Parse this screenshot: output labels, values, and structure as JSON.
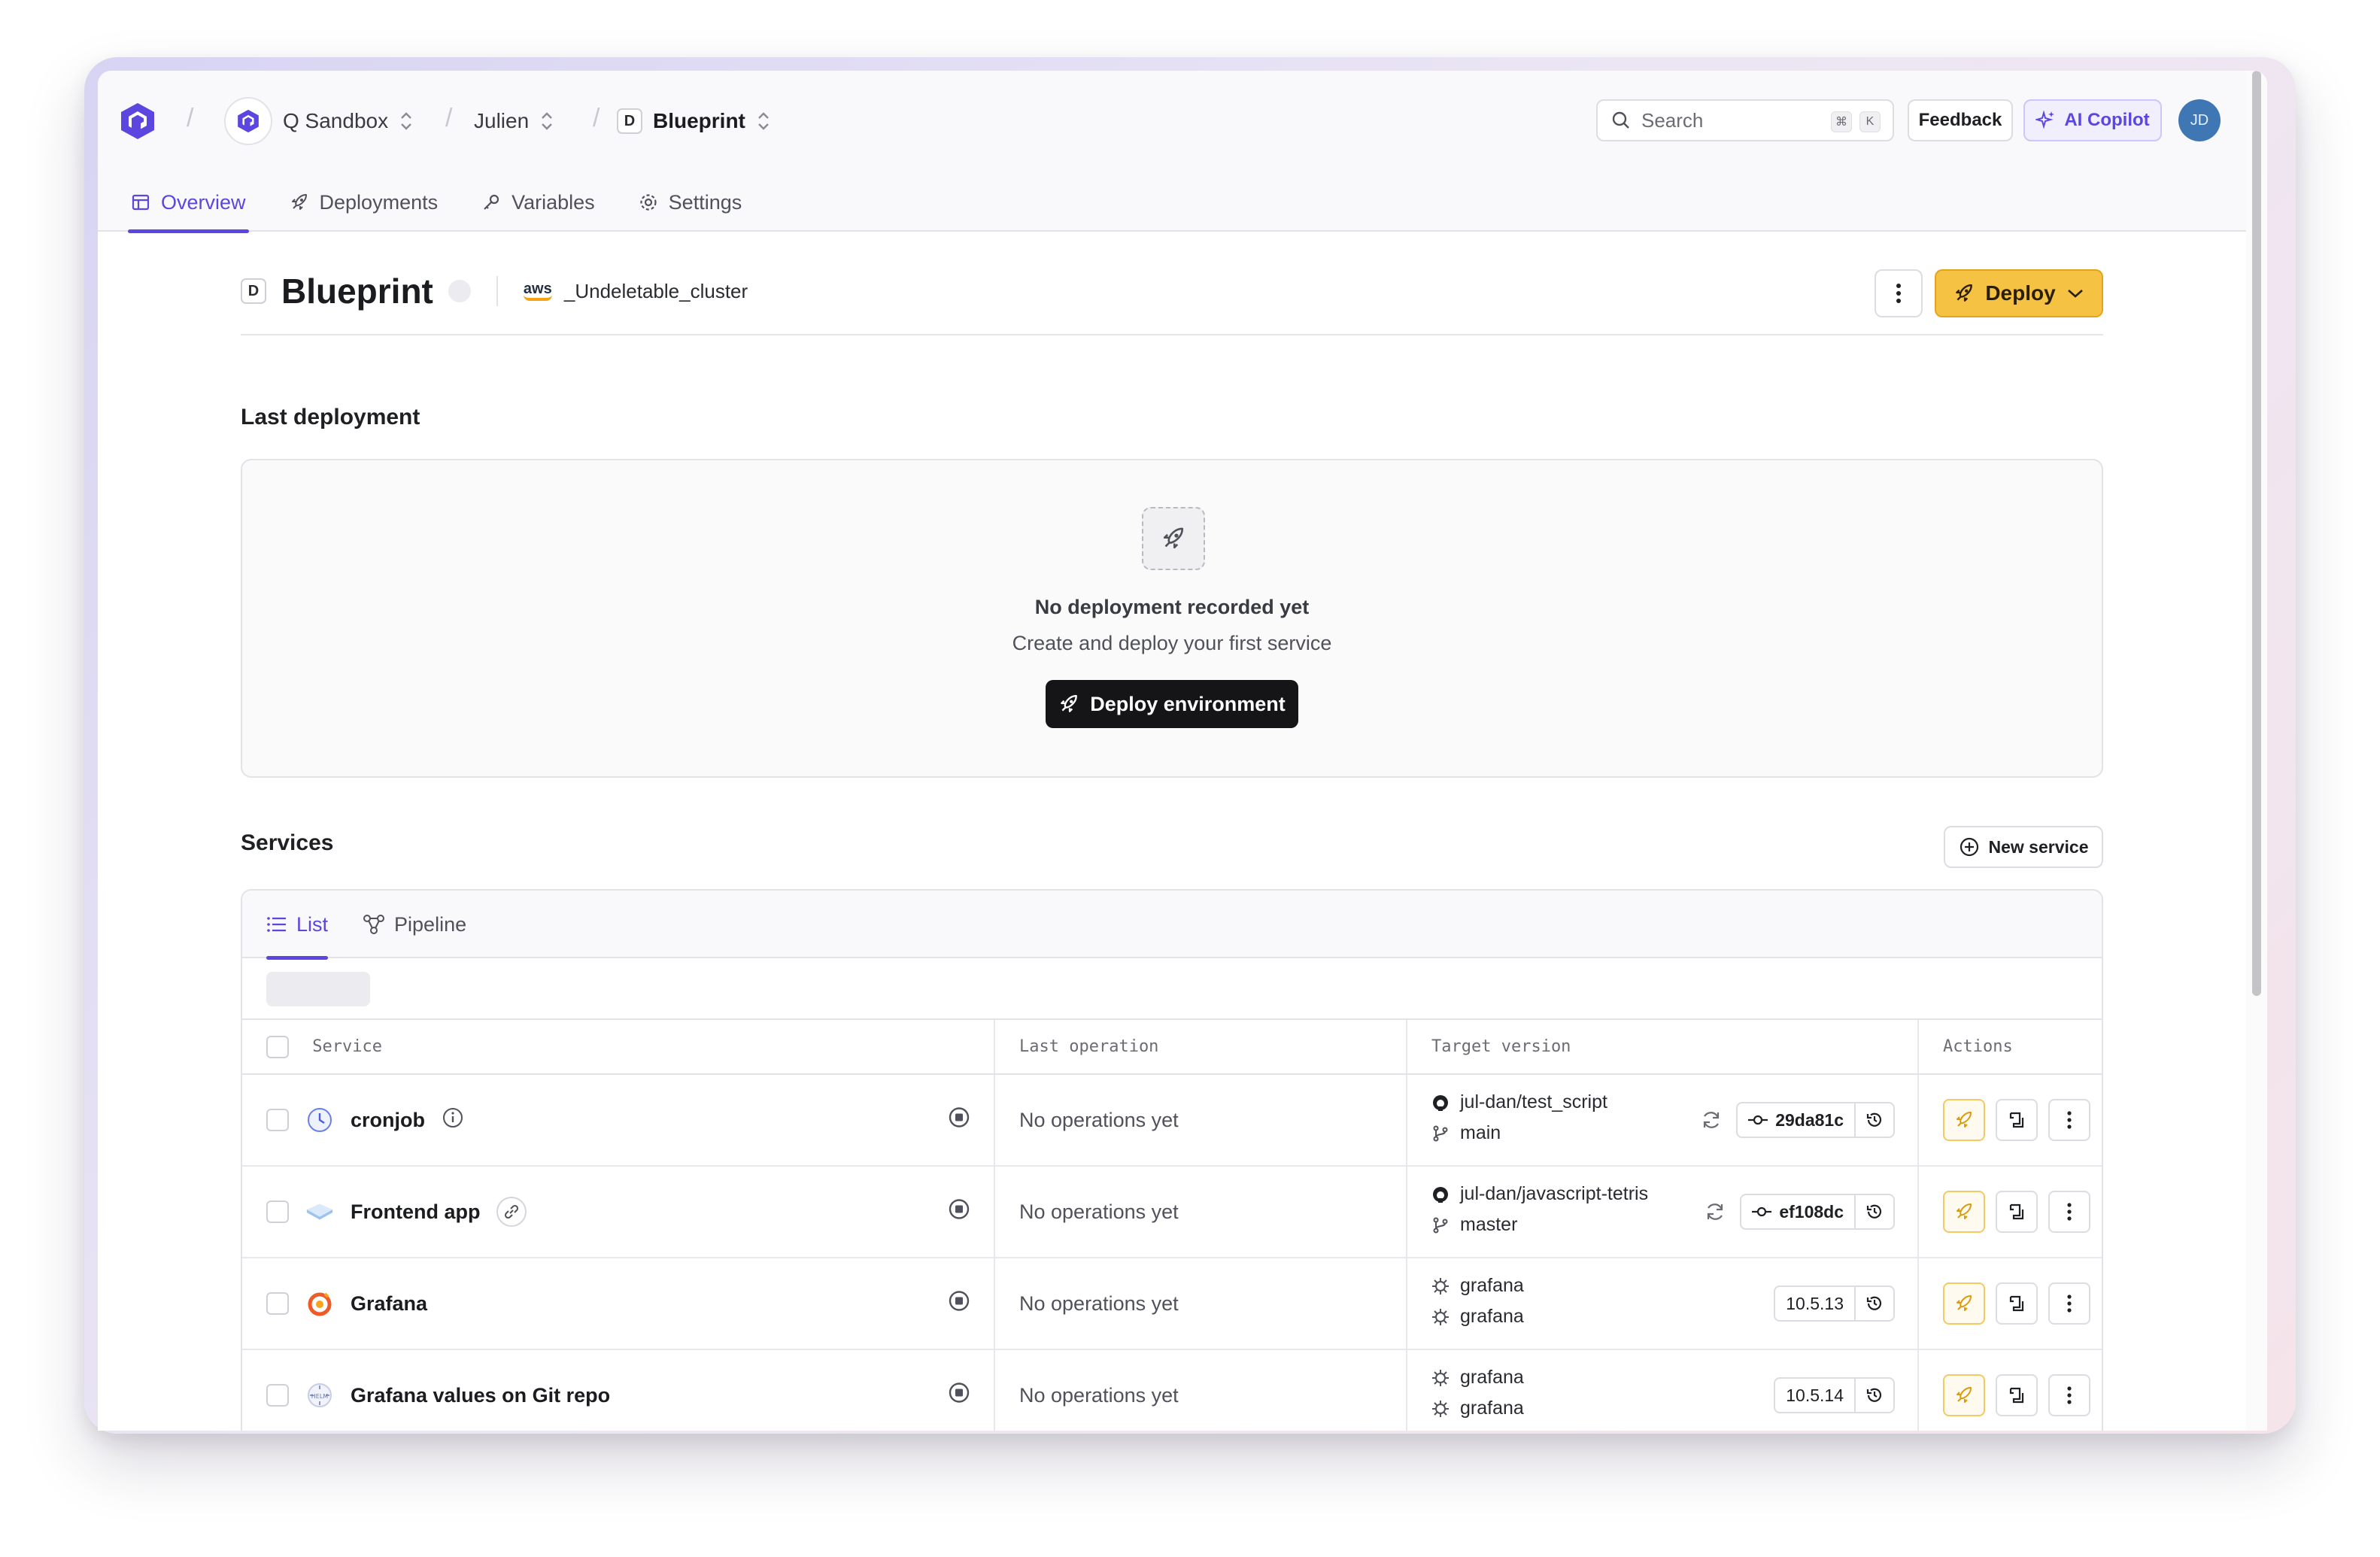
{
  "header": {
    "breadcrumbs": [
      {
        "label": "Q Sandbox"
      },
      {
        "label": "Julien"
      },
      {
        "label": "Blueprint",
        "badge": "D"
      }
    ],
    "search": {
      "placeholder": "Search",
      "shortcut": [
        "⌘",
        "K"
      ]
    },
    "feedback_label": "Feedback",
    "copilot_label": "AI Copilot",
    "user_initials": "JD",
    "tabs": [
      {
        "label": "Overview",
        "active": true,
        "icon": "layout-icon"
      },
      {
        "label": "Deployments",
        "active": false,
        "icon": "rocket-icon"
      },
      {
        "label": "Variables",
        "active": false,
        "icon": "key-icon"
      },
      {
        "label": "Settings",
        "active": false,
        "icon": "gear-icon"
      }
    ]
  },
  "environment": {
    "badge": "D",
    "name": "Blueprint",
    "cloud_logo": "aws",
    "cluster": "_Undeletable_cluster",
    "deploy_label": "Deploy"
  },
  "last_deployment": {
    "title": "Last deployment",
    "empty_title": "No deployment recorded yet",
    "empty_subtitle": "Create and deploy your first service",
    "button_label": "Deploy environment"
  },
  "services": {
    "title": "Services",
    "new_service_label": "New service",
    "tabs": [
      {
        "label": "List",
        "active": true
      },
      {
        "label": "Pipeline",
        "active": false
      }
    ],
    "columns": [
      "Service",
      "Last operation",
      "Target version",
      "Actions"
    ],
    "rows": [
      {
        "name": "cronjob",
        "icon": "clock-icon",
        "meta": "info-icon",
        "last_operation": "No operations yet",
        "repo": "jul-dan/test_script",
        "branch": "main",
        "source": "git",
        "version": "29da81c",
        "version_kind": "commit"
      },
      {
        "name": "Frontend app",
        "icon": "cloud-app-icon",
        "meta": "link-icon",
        "last_operation": "No operations yet",
        "repo": "jul-dan/javascript-tetris",
        "branch": "master",
        "source": "git",
        "version": "ef108dc",
        "version_kind": "commit"
      },
      {
        "name": "Grafana",
        "icon": "grafana-icon",
        "meta": "",
        "last_operation": "No operations yet",
        "repo": "grafana",
        "branch": "grafana",
        "source": "helm",
        "version": "10.5.13",
        "version_kind": "chart"
      },
      {
        "name": "Grafana values on Git repo",
        "icon": "helm-icon",
        "meta": "",
        "last_operation": "No operations yet",
        "repo": "grafana",
        "branch": "grafana",
        "source": "helm",
        "version": "10.5.14",
        "version_kind": "chart"
      }
    ]
  },
  "colors": {
    "accent": "#5b46e0",
    "deploy": "#f6c244",
    "avatar": "#3f77b4"
  }
}
